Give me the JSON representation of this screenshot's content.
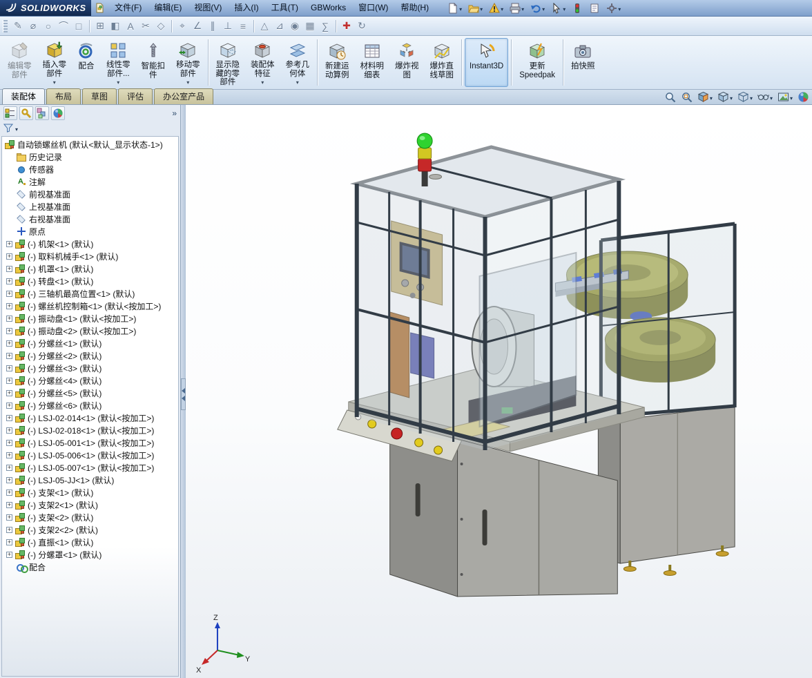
{
  "colors": {
    "titlebar_blue": "#8fb0d8",
    "logo_navy": "#1d3e6e",
    "active_tool_highlight": "#cfe4f7",
    "tab_inactive_tan": "#d5d1ae",
    "bowl_olive": "#9a9a40",
    "frame_steel": "#323c46",
    "signal_green": "#2fd32f",
    "signal_yellow": "#d2c822",
    "signal_red": "#c62828"
  },
  "window": {
    "logo_text": "SOLIDWORKS"
  },
  "menubar": {
    "items": [
      "文件(F)",
      "编辑(E)",
      "视图(V)",
      "插入(I)",
      "工具(T)",
      "GBWorks",
      "窗口(W)",
      "帮助(H)"
    ]
  },
  "quick_access": {
    "icons": [
      {
        "name": "new-document-icon",
        "caret": true
      },
      {
        "name": "open-icon",
        "caret": true
      },
      {
        "name": "save-warning-icon",
        "caret": true
      },
      {
        "name": "print-icon",
        "caret": true
      },
      {
        "name": "undo-icon",
        "caret": true
      },
      {
        "name": "select-arrow-icon",
        "caret": true
      },
      {
        "name": "rebuild-icon",
        "caret": false
      },
      {
        "name": "file-properties-icon",
        "caret": false
      },
      {
        "name": "options-icon",
        "caret": true
      }
    ]
  },
  "toolbar2": {
    "items": [
      {
        "name": "sketch-icon"
      },
      {
        "name": "smart-dimension-icon"
      },
      {
        "name": "circle-icon"
      },
      {
        "name": "arc-icon"
      },
      {
        "name": "rectangle-icon"
      },
      {
        "sep": true
      },
      {
        "name": "pattern-icon"
      },
      {
        "name": "mirror-icon"
      },
      {
        "name": "note-icon"
      },
      {
        "name": "trim-icon"
      },
      {
        "name": "convert-entities-icon"
      },
      {
        "sep": true
      },
      {
        "name": "measure-icon"
      },
      {
        "name": "angle-icon"
      },
      {
        "name": "parallel-icon"
      },
      {
        "name": "perpendicular-icon"
      },
      {
        "name": "layers-icon"
      },
      {
        "sep": true
      },
      {
        "name": "plane-icon"
      },
      {
        "name": "section-icon"
      },
      {
        "name": "appearance-icon"
      },
      {
        "name": "grid-icon"
      },
      {
        "name": "equation-icon"
      },
      {
        "sep": true
      },
      {
        "name": "toolbox-icon"
      },
      {
        "name": "redo-view-icon"
      }
    ]
  },
  "ribbon": {
    "buttons": [
      {
        "name": "edit-component-button",
        "lines": [
          "编辑零",
          "部件"
        ],
        "caret": false,
        "disabled": true
      },
      {
        "name": "insert-components-button",
        "lines": [
          "插入零",
          "部件"
        ],
        "caret": true
      },
      {
        "name": "mate-button",
        "lines": [
          "配合"
        ],
        "caret": false
      },
      {
        "name": "linear-component-pattern-button",
        "lines": [
          "线性零",
          "部件..."
        ],
        "caret": true
      },
      {
        "name": "smart-fasteners-button",
        "lines": [
          "智能扣",
          "件"
        ],
        "caret": false
      },
      {
        "name": "move-component-button",
        "lines": [
          "移动零",
          "部件"
        ],
        "caret": true
      },
      {
        "name": "show-hidden-components-button",
        "lines": [
          "显示隐",
          "藏的零",
          "部件"
        ],
        "caret": false,
        "sep_before": true
      },
      {
        "name": "assembly-features-button",
        "lines": [
          "装配体",
          "特征"
        ],
        "caret": true
      },
      {
        "name": "reference-geometry-button",
        "lines": [
          "参考几",
          "何体"
        ],
        "caret": true
      },
      {
        "name": "new-motion-study-button",
        "lines": [
          "新建运",
          "动算例"
        ],
        "caret": false,
        "sep_before": true
      },
      {
        "name": "bill-of-materials-button",
        "lines": [
          "材料明",
          "细表"
        ],
        "caret": false
      },
      {
        "name": "exploded-view-button",
        "lines": [
          "爆炸视",
          "图"
        ],
        "caret": false
      },
      {
        "name": "explode-line-sketch-button",
        "lines": [
          "爆炸直",
          "线草图"
        ],
        "caret": false
      },
      {
        "name": "instant3d-button",
        "lines": [
          "Instant3D"
        ],
        "caret": false,
        "active": true,
        "sep_before": true
      },
      {
        "name": "update-speedpak-button",
        "lines": [
          "更新",
          "Speedpak"
        ],
        "caret": false,
        "sep_before": true
      },
      {
        "name": "take-snapshot-button",
        "lines": [
          "拍快照"
        ],
        "caret": false,
        "sep_before": true
      }
    ]
  },
  "tabs": {
    "items": [
      {
        "label": "装配体",
        "active": true
      },
      {
        "label": "布局",
        "active": false
      },
      {
        "label": "草图",
        "active": false
      },
      {
        "label": "评估",
        "active": false
      },
      {
        "label": "办公室产品",
        "active": false
      }
    ]
  },
  "panel": {
    "tabs": [
      {
        "name": "featuremanager-tab-icon"
      },
      {
        "name": "propertymanager-tab-icon"
      },
      {
        "name": "configurationmanager-tab-icon"
      },
      {
        "name": "displaymanager-tab-icon"
      }
    ]
  },
  "tree": {
    "root": {
      "label": "自动锁螺丝机 (默认<默认_显示状态-1>)",
      "icon": "assembly"
    },
    "items": [
      {
        "icon": "history",
        "label": "历史记录",
        "expand": false
      },
      {
        "icon": "sensor",
        "label": "传感器",
        "expand": false
      },
      {
        "icon": "annotation",
        "label": "注解",
        "expand": false
      },
      {
        "icon": "plane",
        "label": "前视基准面",
        "expand": false
      },
      {
        "icon": "plane",
        "label": "上视基准面",
        "expand": false
      },
      {
        "icon": "plane",
        "label": "右视基准面",
        "expand": false
      },
      {
        "icon": "origin",
        "label": "原点",
        "expand": false
      },
      {
        "icon": "component",
        "label": "(-) 机架<1> (默认)",
        "expand": true
      },
      {
        "icon": "component",
        "label": "(-) 取料机械手<1> (默认)",
        "expand": true
      },
      {
        "icon": "component",
        "label": "(-) 机罩<1> (默认)",
        "expand": true
      },
      {
        "icon": "component",
        "label": "(-) 转盘<1> (默认)",
        "expand": true
      },
      {
        "icon": "component",
        "label": "(-) 三轴机最高位置<1> (默认)",
        "expand": true
      },
      {
        "icon": "component",
        "label": "(-) 螺丝机控制箱<1> (默认<按加工>)",
        "expand": true
      },
      {
        "icon": "component",
        "label": "(-) 振动盘<1> (默认<按加工>)",
        "expand": true
      },
      {
        "icon": "component",
        "label": "(-) 振动盘<2> (默认<按加工>)",
        "expand": true
      },
      {
        "icon": "component",
        "label": "(-) 分螺丝<1> (默认)",
        "expand": true
      },
      {
        "icon": "component",
        "label": "(-) 分螺丝<2> (默认)",
        "expand": true
      },
      {
        "icon": "component",
        "label": "(-) 分螺丝<3> (默认)",
        "expand": true
      },
      {
        "icon": "component",
        "label": "(-) 分螺丝<4> (默认)",
        "expand": true
      },
      {
        "icon": "component",
        "label": "(-) 分螺丝<5> (默认)",
        "expand": true
      },
      {
        "icon": "component",
        "label": "(-) 分螺丝<6> (默认)",
        "expand": true
      },
      {
        "icon": "component",
        "label": "(-) LSJ-02-014<1> (默认<按加工>)",
        "expand": true
      },
      {
        "icon": "component",
        "label": "(-) LSJ-02-018<1> (默认<按加工>)",
        "expand": true
      },
      {
        "icon": "component",
        "label": "(-) LSJ-05-001<1> (默认<按加工>)",
        "expand": true
      },
      {
        "icon": "component",
        "label": "(-) LSJ-05-006<1> (默认<按加工>)",
        "expand": true
      },
      {
        "icon": "component",
        "label": "(-) LSJ-05-007<1> (默认<按加工>)",
        "expand": true
      },
      {
        "icon": "component",
        "label": "(-) LSJ-05-JJ<1> (默认)",
        "expand": true
      },
      {
        "icon": "component",
        "label": "(-) 支架<1> (默认)",
        "expand": true
      },
      {
        "icon": "component",
        "label": "(-) 支架2<1> (默认)",
        "expand": true
      },
      {
        "icon": "component",
        "label": "(-) 支架<2> (默认)",
        "expand": true
      },
      {
        "icon": "component",
        "label": "(-) 支架2<2> (默认)",
        "expand": true
      },
      {
        "icon": "component",
        "label": "(-) 直振<1> (默认)",
        "expand": true
      },
      {
        "icon": "component",
        "label": "(-) 分螺罩<1> (默认)",
        "expand": true
      },
      {
        "icon": "mates",
        "label": "配合",
        "expand": false
      }
    ]
  },
  "viewport": {
    "toolbar": [
      {
        "name": "zoom-fit-icon",
        "caret": false
      },
      {
        "name": "zoom-area-icon",
        "caret": false
      },
      {
        "name": "section-view-icon",
        "caret": true
      },
      {
        "name": "view-orientation-icon",
        "caret": true
      },
      {
        "name": "display-style-icon",
        "caret": true
      },
      {
        "name": "hide-show-items-icon",
        "caret": true
      },
      {
        "name": "apply-scene-icon",
        "caret": true
      },
      {
        "name": "edit-appearance-icon",
        "caret": false
      }
    ],
    "triad": {
      "x": "X",
      "y": "Y",
      "z": "Z"
    }
  }
}
